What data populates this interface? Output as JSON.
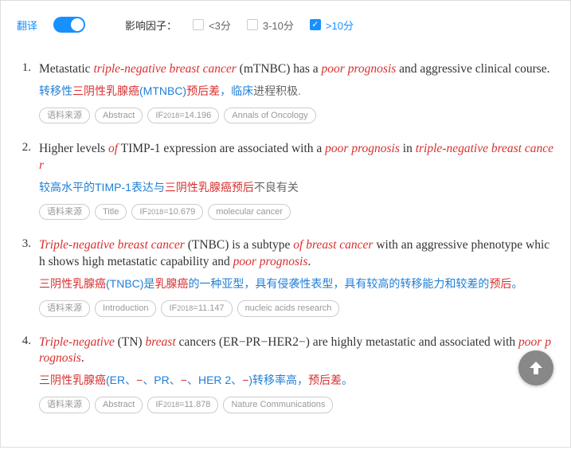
{
  "header": {
    "translate_label": "翻译",
    "factor_label": "影响因子：",
    "filters": [
      {
        "label": "<3分",
        "checked": false
      },
      {
        "label": "3-10分",
        "checked": false
      },
      {
        "label": ">10分",
        "checked": true
      }
    ]
  },
  "entries": [
    {
      "num": "1.",
      "en_parts": [
        {
          "t": "Metastatic ",
          "h": false
        },
        {
          "t": "triple-negative breast cancer",
          "h": true
        },
        {
          "t": " (mTNBC) has a ",
          "h": false
        },
        {
          "t": "poor prognosis",
          "h": true
        },
        {
          "t": " and aggressive clinical course.",
          "h": false
        }
      ],
      "cn_parts": [
        {
          "t": "转移性",
          "c": "blue"
        },
        {
          "t": "三阴性乳腺癌",
          "c": "red"
        },
        {
          "t": "(MTNBC)",
          "c": "blue"
        },
        {
          "t": "预后差",
          "c": "red"
        },
        {
          "t": "，临床",
          "c": "blue"
        },
        {
          "t": "进程积极",
          "c": "plain"
        },
        {
          "t": ".",
          "c": "blue"
        }
      ],
      "tags": [
        "语料来源",
        "Abstract",
        "IF₂₀₁₈=14.196",
        "Annals of Oncology"
      ]
    },
    {
      "num": "2.",
      "en_parts": [
        {
          "t": "Higher levels ",
          "h": false
        },
        {
          "t": "of",
          "h": true
        },
        {
          "t": " TIMP-1 expression are associated with a ",
          "h": false
        },
        {
          "t": "poor prognosis",
          "h": true
        },
        {
          "t": " in ",
          "h": false
        },
        {
          "t": "triple-negative breast cancer",
          "h": true
        }
      ],
      "cn_parts": [
        {
          "t": "较高水平的TIMP-1表达与",
          "c": "blue"
        },
        {
          "t": "三阴性乳腺癌预后",
          "c": "red"
        },
        {
          "t": "不良有关",
          "c": "plain"
        }
      ],
      "tags": [
        "语料来源",
        "Title",
        "IF₂₀₁₈=10.679",
        "molecular cancer"
      ]
    },
    {
      "num": "3.",
      "en_parts": [
        {
          "t": "Triple-negative breast cancer",
          "h": true
        },
        {
          "t": " (TNBC) is a subtype ",
          "h": false
        },
        {
          "t": "of breast cancer",
          "h": true
        },
        {
          "t": " with an aggressive phenotype which shows high metastatic capability and ",
          "h": false
        },
        {
          "t": "poor prognosis",
          "h": true
        },
        {
          "t": ".",
          "h": false
        }
      ],
      "cn_parts": [
        {
          "t": "三阴性乳腺癌",
          "c": "red"
        },
        {
          "t": "(TNBC)是",
          "c": "blue"
        },
        {
          "t": "乳腺癌",
          "c": "red"
        },
        {
          "t": "的一种亚型，具有侵袭性表型，具有较高的转移能力和较差的",
          "c": "blue"
        },
        {
          "t": "预后",
          "c": "red"
        },
        {
          "t": "。",
          "c": "blue"
        }
      ],
      "tags": [
        "语料来源",
        "Introduction",
        "IF₂₀₁₈=11.147",
        "nucleic acids research"
      ]
    },
    {
      "num": "4.",
      "en_parts": [
        {
          "t": "Triple-negative",
          "h": true
        },
        {
          "t": " (TN) ",
          "h": false
        },
        {
          "t": "breast",
          "h": true
        },
        {
          "t": " cancers (ER−PR−HER2−) are highly metastatic and associated with ",
          "h": false
        },
        {
          "t": "poor prognosis",
          "h": true
        },
        {
          "t": ".",
          "h": false
        }
      ],
      "cn_parts": [
        {
          "t": "三阴性乳腺癌",
          "c": "red"
        },
        {
          "t": "(ER、",
          "c": "blue"
        },
        {
          "t": "−",
          "c": "red"
        },
        {
          "t": "、PR、",
          "c": "blue"
        },
        {
          "t": "−",
          "c": "red"
        },
        {
          "t": "、HER 2、",
          "c": "blue"
        },
        {
          "t": "−",
          "c": "red"
        },
        {
          "t": ")转移率高，",
          "c": "blue"
        },
        {
          "t": "预后差",
          "c": "red"
        },
        {
          "t": "。",
          "c": "blue"
        }
      ],
      "tags": [
        "语料来源",
        "Abstract",
        "IF₂₀₁₈=11.878",
        "Nature Communications"
      ]
    }
  ],
  "scroll_top_icon": "arrow-up"
}
